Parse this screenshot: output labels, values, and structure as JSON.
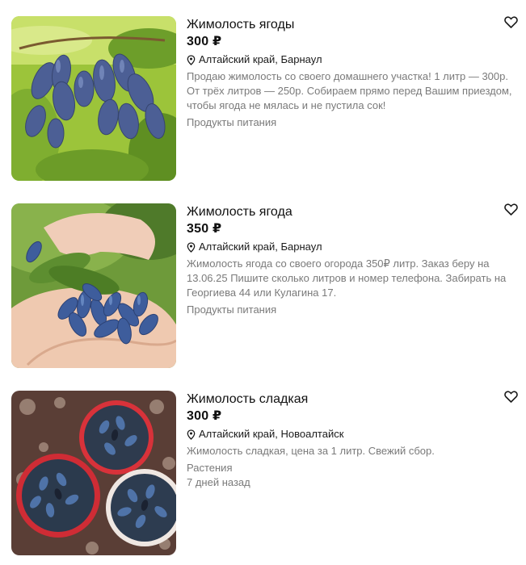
{
  "listings": [
    {
      "title": "Жимолость ягоды",
      "price": "300 ₽",
      "location": "Алтайский край, Барнаул",
      "description": "Продаю жимолость со своего домашнего участка! 1 литр — 300р. От трёх литров — 250р. Собираем прямо перед Вашим приездом, чтобы ягода не мялась и не пустила сок!",
      "category": "Продукты питания"
    },
    {
      "title": "Жимолость ягода",
      "price": "350 ₽",
      "location": "Алтайский край, Барнаул",
      "description": "Жимолость ягода со своего огорода 350₽ литр. Заказ беру на 13.06.25 Пишите сколько литров и номер телефона. Забирать на Георгиева 44 или Кулагина 17.",
      "category": "Продукты питания"
    },
    {
      "title": "Жимолость сладкая",
      "price": "300 ₽",
      "location": "Алтайский край, Новоалтайск",
      "description": "Жимолость сладкая, цена за 1 литр. Свежий сбор.",
      "category": "Растения",
      "age": "7 дней назад"
    }
  ],
  "icons": {
    "location": "map-pin-icon",
    "favorite": "heart-icon"
  },
  "colors": {
    "text": "#1a1a1a",
    "muted": "#7a7a7a",
    "berry": "#4a5f94"
  }
}
